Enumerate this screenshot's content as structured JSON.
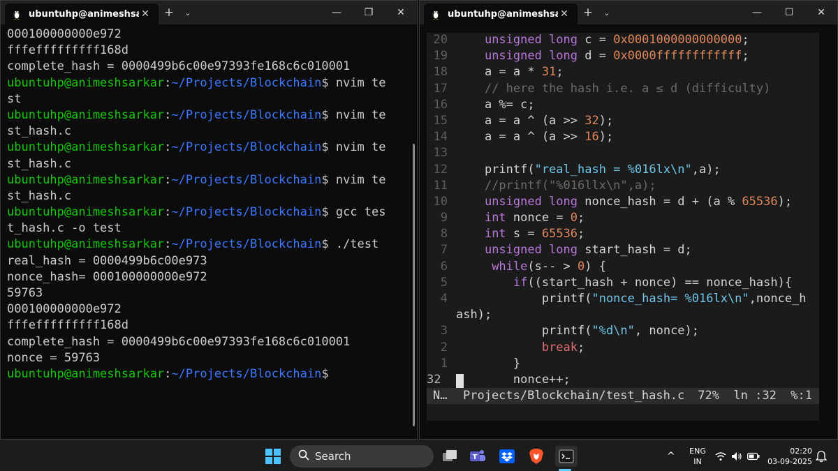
{
  "left_window": {
    "tab_title": "ubuntuhp@animeshsark",
    "new_tab": "+",
    "dropdown": "⌄",
    "close": "✕",
    "controls": {
      "minimize": "—",
      "maximize": "❐",
      "close": "✕"
    },
    "lines": [
      {
        "text": "000100000000e972"
      },
      {
        "text": "fffefffffffff168d"
      },
      {
        "text": "complete_hash = 0000499b6c00e97393fe168c6c010001"
      },
      {
        "user": "ubuntuhp@animeshsarkar",
        "sep": ":",
        "path": "~/Projects/Blockchain",
        "cmd": "$ nvim te"
      },
      {
        "text": "st"
      },
      {
        "user": "ubuntuhp@animeshsarkar",
        "sep": ":",
        "path": "~/Projects/Blockchain",
        "cmd": "$ nvim te"
      },
      {
        "text": "st_hash.c"
      },
      {
        "user": "ubuntuhp@animeshsarkar",
        "sep": ":",
        "path": "~/Projects/Blockchain",
        "cmd": "$ nvim te"
      },
      {
        "text": "st_hash.c"
      },
      {
        "user": "ubuntuhp@animeshsarkar",
        "sep": ":",
        "path": "~/Projects/Blockchain",
        "cmd": "$ nvim te"
      },
      {
        "text": "st_hash.c"
      },
      {
        "user": "ubuntuhp@animeshsarkar",
        "sep": ":",
        "path": "~/Projects/Blockchain",
        "cmd": "$ gcc tes"
      },
      {
        "text": "t_hash.c -o test"
      },
      {
        "user": "ubuntuhp@animeshsarkar",
        "sep": ":",
        "path": "~/Projects/Blockchain",
        "cmd": "$ ./test"
      },
      {
        "text": "real_hash = 0000499b6c00e973"
      },
      {
        "text": "nonce_hash= 000100000000e972"
      },
      {
        "text": "59763"
      },
      {
        "text": "000100000000e972"
      },
      {
        "text": "fffefffffffff168d"
      },
      {
        "text": "complete_hash = 0000499b6c00e97393fe168c6c010001"
      },
      {
        "text": "nonce = 59763"
      },
      {
        "user": "ubuntuhp@animeshsarkar",
        "sep": ":",
        "path": "~/Projects/Blockchain",
        "cmd": "$"
      }
    ]
  },
  "right_window": {
    "tab_title": "ubuntuhp@animeshsark",
    "new_tab": "+",
    "dropdown": "⌄",
    "close": "✕",
    "controls": {
      "minimize": "—",
      "maximize": "☐",
      "close": "✕"
    },
    "editor_lines": [
      {
        "n": "20",
        "code": [
          [
            "    ",
            ""
          ],
          [
            "unsigned long",
            "kw"
          ],
          [
            " c = ",
            ""
          ],
          [
            "0x0001000000000000",
            "num"
          ],
          [
            ";",
            ""
          ]
        ]
      },
      {
        "n": "19",
        "code": [
          [
            "    ",
            ""
          ],
          [
            "unsigned long",
            "kw"
          ],
          [
            " d = ",
            ""
          ],
          [
            "0x0000ffffffffffff",
            "num"
          ],
          [
            ";",
            ""
          ]
        ]
      },
      {
        "n": "18",
        "code": [
          [
            "    a = a * ",
            ""
          ],
          [
            "31",
            "num"
          ],
          [
            ";",
            ""
          ]
        ]
      },
      {
        "n": "17",
        "code": [
          [
            "    ",
            ""
          ],
          [
            "// here the hash i.e. a ≤ d (difficulty)",
            "cmt"
          ]
        ]
      },
      {
        "n": "16",
        "code": [
          [
            "    a %= c;",
            ""
          ]
        ]
      },
      {
        "n": "15",
        "code": [
          [
            "    a = a ^ (a >> ",
            ""
          ],
          [
            "32",
            "num"
          ],
          [
            ");",
            ""
          ]
        ]
      },
      {
        "n": "14",
        "code": [
          [
            "    a = a ^ (a >> ",
            ""
          ],
          [
            "16",
            "num"
          ],
          [
            ");",
            ""
          ]
        ]
      },
      {
        "n": "13",
        "code": []
      },
      {
        "n": "12",
        "code": [
          [
            "    printf(",
            ""
          ],
          [
            "\"real_hash = %016lx\\n\"",
            "str"
          ],
          [
            ",a);",
            ""
          ]
        ]
      },
      {
        "n": "11",
        "code": [
          [
            "    ",
            ""
          ],
          [
            "//printf(\"%016llx\\n\",a);",
            "cmt"
          ]
        ]
      },
      {
        "n": "10",
        "code": [
          [
            "    ",
            ""
          ],
          [
            "unsigned long",
            "kw"
          ],
          [
            " nonce_hash = d + (a % ",
            ""
          ],
          [
            "65536",
            "num"
          ],
          [
            ");",
            ""
          ]
        ]
      },
      {
        "n": "9",
        "code": [
          [
            "    ",
            ""
          ],
          [
            "int",
            "kw"
          ],
          [
            " nonce = ",
            ""
          ],
          [
            "0",
            "num"
          ],
          [
            ";",
            ""
          ]
        ]
      },
      {
        "n": "8",
        "code": [
          [
            "    ",
            ""
          ],
          [
            "int",
            "kw"
          ],
          [
            " s = ",
            ""
          ],
          [
            "65536",
            "num"
          ],
          [
            ";",
            ""
          ]
        ]
      },
      {
        "n": "7",
        "code": [
          [
            "    ",
            ""
          ],
          [
            "unsigned long",
            "kw"
          ],
          [
            " start_hash = d;",
            ""
          ]
        ]
      },
      {
        "n": "6",
        "code": [
          [
            "     ",
            ""
          ],
          [
            "while",
            "kw"
          ],
          [
            "(s-- > ",
            ""
          ],
          [
            "0",
            "num"
          ],
          [
            ") {",
            ""
          ]
        ]
      },
      {
        "n": "5",
        "code": [
          [
            "        ",
            ""
          ],
          [
            "if",
            "kw"
          ],
          [
            "((start_hash + nonce) == nonce_hash){",
            ""
          ]
        ]
      },
      {
        "n": "4",
        "code": [
          [
            "            printf(",
            ""
          ],
          [
            "\"nonce_hash= %016lx\\n\"",
            "str"
          ],
          [
            ",nonce_h",
            ""
          ]
        ]
      },
      {
        "n": "",
        "code": [
          [
            "ash);",
            ""
          ]
        ],
        "wrap": true
      },
      {
        "n": "3",
        "code": [
          [
            "            printf(",
            ""
          ],
          [
            "\"%d\\n\"",
            "str"
          ],
          [
            ", nonce);",
            ""
          ]
        ]
      },
      {
        "n": "2",
        "code": [
          [
            "            ",
            ""
          ],
          [
            "break",
            "red"
          ],
          [
            ";",
            ""
          ]
        ]
      },
      {
        "n": "1",
        "code": [
          [
            "        }",
            ""
          ]
        ]
      },
      {
        "n": "32",
        "code": [
          [
            "        nonce++;",
            ""
          ]
        ],
        "cursor": true
      }
    ],
    "status": {
      "mode": "N…",
      "file": "Projects/Blockchain/test_hash.c",
      "position": "72%  ln :32  %:1"
    }
  },
  "taskbar": {
    "search_label": "Search",
    "language_top": "ENG",
    "language_bottom": "IN",
    "time": "02:20",
    "date": "03-09-2025",
    "chevron": "^",
    "colors": {
      "accent": "#60cdff",
      "brave": "#fb542b",
      "teams": "#5b5fc7",
      "dropbox": "#0061fe"
    }
  }
}
